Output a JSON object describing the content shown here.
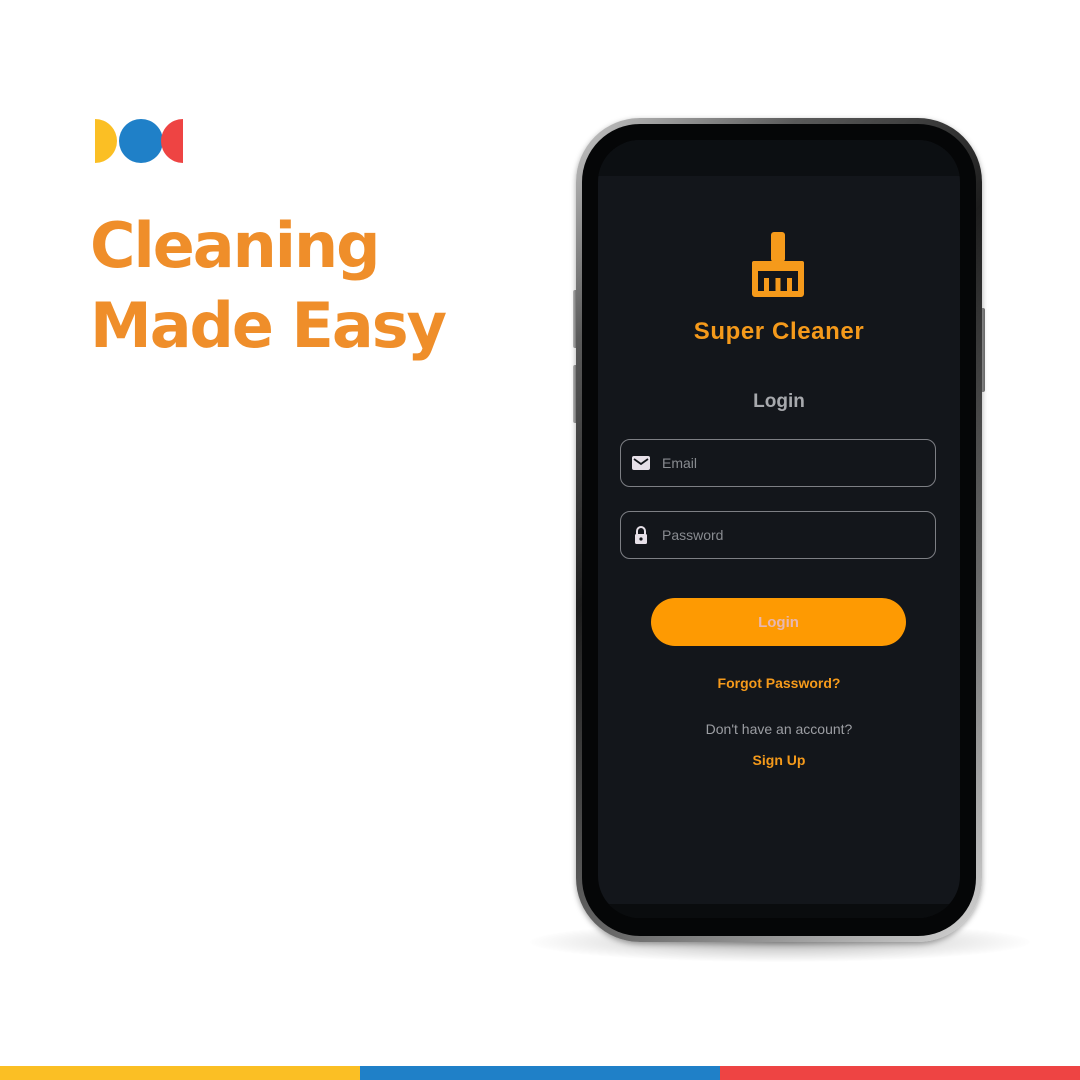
{
  "brand": {
    "logo_icon": "three-dot-logo-icon",
    "logo_colors": [
      "#fbbf24",
      "#1f80c8",
      "#ee4443"
    ]
  },
  "headline": {
    "line1": "Cleaning",
    "line2": "Made Easy",
    "color": "#ef8e2a"
  },
  "app": {
    "icon": "broom-icon",
    "title": "Super Cleaner",
    "screen_title": "Login",
    "email": {
      "icon": "mail-icon",
      "placeholder": "Email",
      "value": ""
    },
    "password": {
      "icon": "lock-icon",
      "placeholder": "Password",
      "value": ""
    },
    "login_button": "Login",
    "forgot_password": "Forgot Password?",
    "no_account_text": "Don't have an account?",
    "signup_link": "Sign Up",
    "accent_color": "#fe9a02",
    "background_color": "#13161b"
  },
  "footer": {
    "bar_colors": [
      "#fbbf24",
      "#1f80c8",
      "#ee4443"
    ]
  }
}
